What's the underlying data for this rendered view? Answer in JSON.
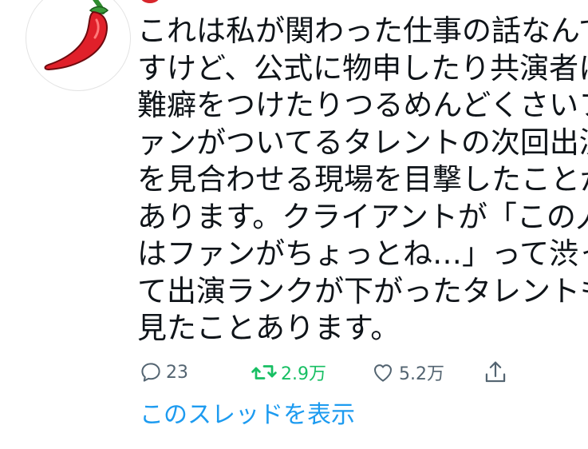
{
  "tweet": {
    "lines": [
      "これは私が関わった仕事の話なんで",
      "すけど、公式に物申したり共演者に",
      "難癖をつけたりつるめんどくさいフ",
      "ァンがついてるタレントの次回出演",
      "を見合わせる現場を目撃したことが",
      "あります。クライアントが「この人",
      "はファンがちょっとね…」って渋っ",
      "て出演ランクが下がったタレントも",
      "見たことあります。"
    ]
  },
  "actions": {
    "reply_count": "23",
    "retweet_count": "2.9万",
    "like_count": "5.2万"
  },
  "show_thread_label": "このスレッドを表示",
  "colors": {
    "text": "#0f1419",
    "muted": "#536471",
    "retweet_active": "#17bf63",
    "link": "#1d9bf0"
  },
  "icons": {
    "avatar": "red-chili-pepper",
    "reply": "reply-icon",
    "retweet": "retweet-icon",
    "like": "heart-icon",
    "share": "share-icon"
  }
}
